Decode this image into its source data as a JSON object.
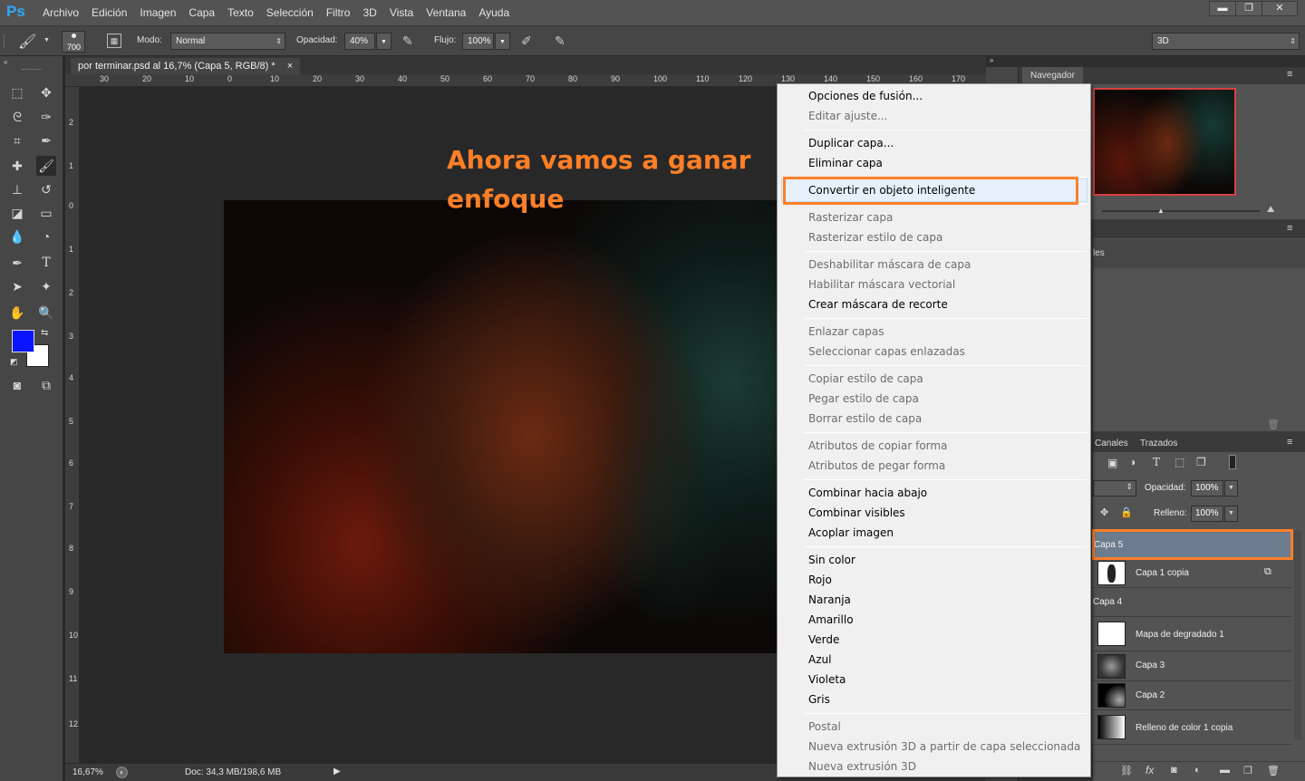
{
  "app": {
    "logo": "Ps"
  },
  "menu": [
    "Archivo",
    "Edición",
    "Imagen",
    "Capa",
    "Texto",
    "Selección",
    "Filtro",
    "3D",
    "Vista",
    "Ventana",
    "Ayuda"
  ],
  "window_buttons": {
    "minimize": "▬",
    "restore": "❐",
    "close": "✕"
  },
  "options": {
    "brush_size": "700",
    "mode_label": "Modo:",
    "mode_value": "Normal",
    "opacity_label": "Opacidad:",
    "opacity_value": "40%",
    "flow_label": "Flujo:",
    "flow_value": "100%",
    "workspace": "3D"
  },
  "document": {
    "tab_title": "por terminar.psd al 16,7% (Capa 5, RGB/8) *",
    "ruler_top": [
      "30",
      "20",
      "10",
      "0",
      "10",
      "20",
      "30",
      "40",
      "50",
      "60",
      "70",
      "80",
      "90",
      "100",
      "110",
      "120",
      "130",
      "140",
      "150",
      "160",
      "170"
    ],
    "ruler_left": [
      "2",
      "1",
      "0",
      "1",
      "2",
      "3",
      "4",
      "5",
      "6",
      "7",
      "8",
      "9",
      "10",
      "11",
      "12"
    ],
    "annotation_line1": "Ahora vamos a ganar",
    "annotation_line2": "enfoque",
    "zoom": "16,67%",
    "doc_info": "Doc: 34,3 MB/198,6 MB"
  },
  "navigator": {
    "title": "Navegador"
  },
  "panels": {
    "styles_partial": "les",
    "channels_tab": "Canales",
    "paths_tab": "Trazados"
  },
  "layers_panel": {
    "opacity_label": "Opacidad:",
    "opacity_value": "100%",
    "fill_label": "Relleno:",
    "fill_value": "100%",
    "layers": [
      "Capa 5",
      "Capa 1 copia",
      "Capa 4",
      "Mapa de degradado 1",
      "Capa 3",
      "Capa 2",
      "Relleno de color 1 copia"
    ],
    "footer_fx": "fx"
  },
  "context_menu": {
    "items": [
      {
        "label": "Opciones de fusión...",
        "enabled": true
      },
      {
        "label": "Editar ajuste...",
        "enabled": false
      },
      {
        "label": "Duplicar capa...",
        "enabled": true
      },
      {
        "label": "Eliminar capa",
        "enabled": true
      },
      {
        "label": "Convertir en objeto inteligente",
        "enabled": true
      },
      {
        "label": "Rasterizar capa",
        "enabled": false
      },
      {
        "label": "Rasterizar estilo de capa",
        "enabled": false
      },
      {
        "label": "Deshabilitar máscara de capa",
        "enabled": false
      },
      {
        "label": "Habilitar máscara vectorial",
        "enabled": false
      },
      {
        "label": "Crear máscara de recorte",
        "enabled": true
      },
      {
        "label": "Enlazar capas",
        "enabled": false
      },
      {
        "label": "Seleccionar capas enlazadas",
        "enabled": false
      },
      {
        "label": "Copiar estilo de capa",
        "enabled": false
      },
      {
        "label": "Pegar estilo de capa",
        "enabled": false
      },
      {
        "label": "Borrar estilo de capa",
        "enabled": false
      },
      {
        "label": "Atributos de copiar forma",
        "enabled": false
      },
      {
        "label": "Atributos de pegar forma",
        "enabled": false
      },
      {
        "label": "Combinar hacia abajo",
        "enabled": true
      },
      {
        "label": "Combinar visibles",
        "enabled": true
      },
      {
        "label": "Acoplar imagen",
        "enabled": true
      },
      {
        "label": "Sin color",
        "enabled": true
      },
      {
        "label": "Rojo",
        "enabled": true
      },
      {
        "label": "Naranja",
        "enabled": true
      },
      {
        "label": "Amarillo",
        "enabled": true
      },
      {
        "label": "Verde",
        "enabled": true
      },
      {
        "label": "Azul",
        "enabled": true
      },
      {
        "label": "Violeta",
        "enabled": true
      },
      {
        "label": "Gris",
        "enabled": true
      },
      {
        "label": "Postal",
        "enabled": false
      },
      {
        "label": "Nueva extrusión 3D a partir de capa seleccionada",
        "enabled": false
      },
      {
        "label": "Nueva extrusión 3D",
        "enabled": false
      }
    ]
  },
  "colors": {
    "foreground": "#0a14ff",
    "background": "#ffffff",
    "highlight": "#ff7f27"
  }
}
